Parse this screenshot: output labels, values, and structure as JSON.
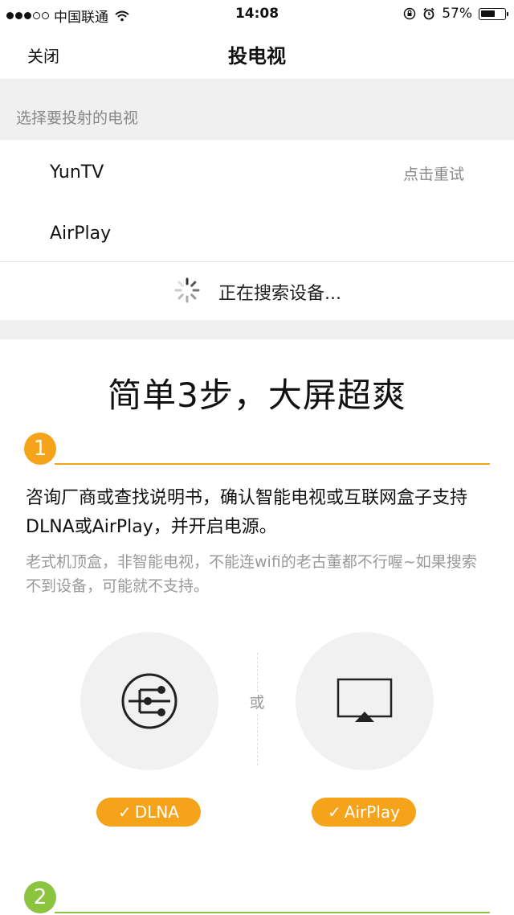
{
  "status_bar": {
    "carrier": "中国联通",
    "time": "14:08",
    "battery": "57%",
    "signal_strength": 3,
    "battery_level": 0.57
  },
  "nav": {
    "close_label": "关闭",
    "title": "投电视"
  },
  "devices": {
    "section_label": "选择要投射的电视",
    "items": [
      {
        "name": "YunTV",
        "action": "点击重试"
      },
      {
        "name": "AirPlay"
      }
    ],
    "searching_text": "正在搜索设备..."
  },
  "guide": {
    "title": "简单3步，大屏超爽",
    "steps": [
      {
        "number": "1",
        "description": "咨询厂商或查找说明书，确认智能电视或互联网盒子支持DLNA或AirPlay，并开启电源。",
        "note": "老式机顶盒，非智能电视，不能连wifi的老古董都不行喔~如果搜索不到设备，可能就不支持。",
        "options": [
          {
            "badge": "DLNA",
            "icon": "dlna-icon"
          },
          {
            "badge": "AirPlay",
            "icon": "airplay-icon"
          }
        ],
        "or_label": "或"
      },
      {
        "number": "2"
      }
    ]
  },
  "colors": {
    "accent_orange": "#f5a31a",
    "step2_green": "#8bc53f",
    "section_bg": "#f0f0f0",
    "muted_text": "#888888"
  }
}
